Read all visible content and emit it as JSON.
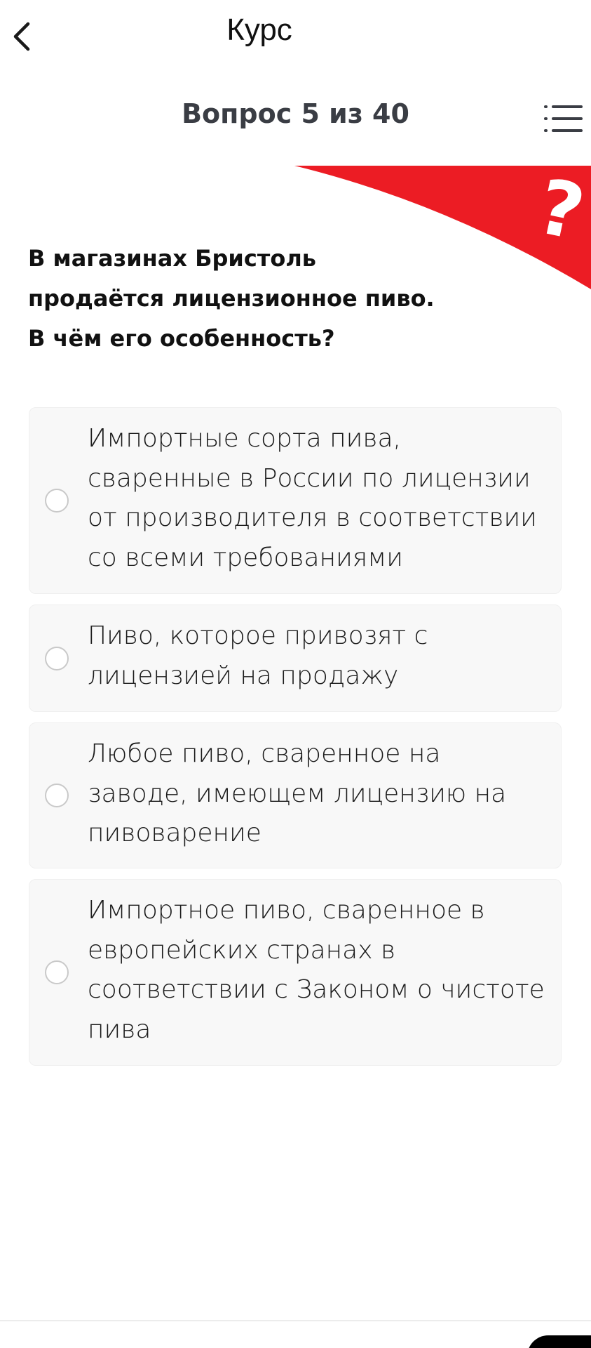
{
  "header": {
    "title": "Курс",
    "back_icon": "chevron-left-icon"
  },
  "progress": {
    "label": "Вопрос 5 из 40",
    "current": 5,
    "total": 40,
    "menu_icon": "list-menu-icon"
  },
  "decor": {
    "accent_color": "#ec1c24",
    "question_mark": "?"
  },
  "question": {
    "lines": [
      "В магазинах Бристоль",
      "продаётся лицензионное пиво.",
      "В чём его особенность?"
    ]
  },
  "options": [
    {
      "selected": false,
      "lines": [
        "Импортные сорта пива,",
        "сваренные в России по лицензии",
        "от производителя в соответствии",
        "со всеми требованиями"
      ]
    },
    {
      "selected": false,
      "lines": [
        "Пиво, которое привозят с",
        "лицензией на продажу"
      ]
    },
    {
      "selected": false,
      "lines": [
        "Любое пиво, сваренное на",
        "заводе, имеющем лицензию на",
        "пивоварение"
      ]
    },
    {
      "selected": false,
      "lines": [
        "Импортное пиво, сваренное в",
        "европейских странах в",
        "соответствии с Законом о чистоте",
        "пива"
      ]
    }
  ]
}
